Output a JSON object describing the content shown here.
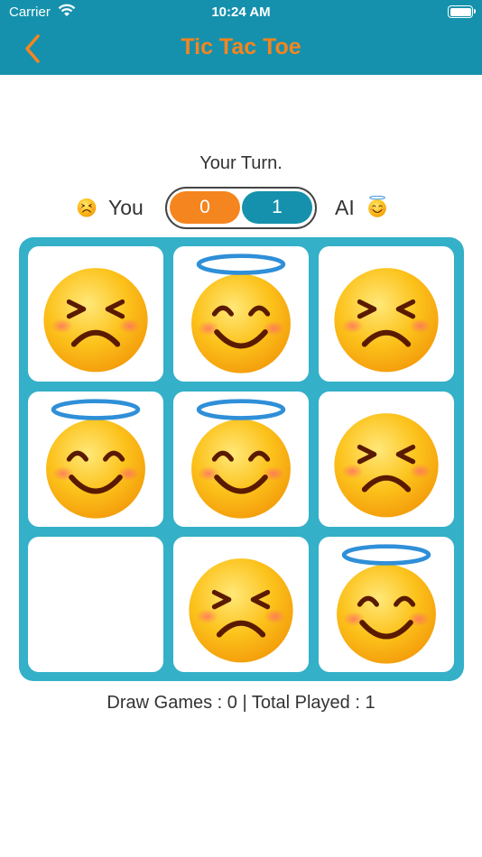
{
  "status_bar": {
    "carrier": "Carrier",
    "time": "10:24 AM"
  },
  "nav": {
    "title": "Tic Tac Toe",
    "back_icon": "chevron-left-icon"
  },
  "colors": {
    "header": "#1591ad",
    "accent": "#f5851f",
    "board": "#34b0c8"
  },
  "turn_text": "Your Turn.",
  "score": {
    "you_label": "You",
    "you_score": "0",
    "ai_score": "1",
    "ai_label": "AI"
  },
  "board": [
    [
      "angry",
      "angel",
      "angry"
    ],
    [
      "angel",
      "angel",
      "angry"
    ],
    [
      "",
      "angry",
      "angel"
    ]
  ],
  "stats": "Draw Games : 0 | Total Played : 1"
}
